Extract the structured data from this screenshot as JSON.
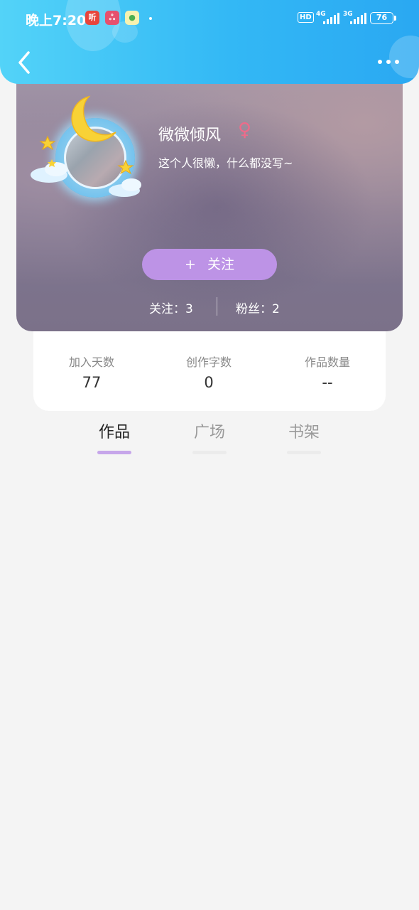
{
  "status_bar": {
    "time": "晚上7:20",
    "apps": [
      "听",
      "ஃ",
      "●"
    ],
    "hd": "HD",
    "network1": "4G",
    "network2": "3G",
    "battery": "76"
  },
  "header": {
    "back_icon": "chevron-left-icon",
    "more_icon": "more-horizontal-icon",
    "accent_color": "#33b8f5"
  },
  "profile": {
    "username": "微微倾风",
    "gender_symbol": "♀",
    "bio": "这个人很懒，什么都没写~",
    "follow_plus": "+",
    "follow_label": "关注",
    "follow_color": "#bd93e6",
    "following_text": "关注：3",
    "fans_text": "粉丝：2"
  },
  "stats": [
    {
      "label": "加入天数",
      "value": "77"
    },
    {
      "label": "创作字数",
      "value": "0"
    },
    {
      "label": "作品数量",
      "value": "--"
    }
  ],
  "tabs": [
    {
      "label": "作品",
      "active": true
    },
    {
      "label": "广场",
      "active": false
    },
    {
      "label": "书架",
      "active": false
    }
  ]
}
